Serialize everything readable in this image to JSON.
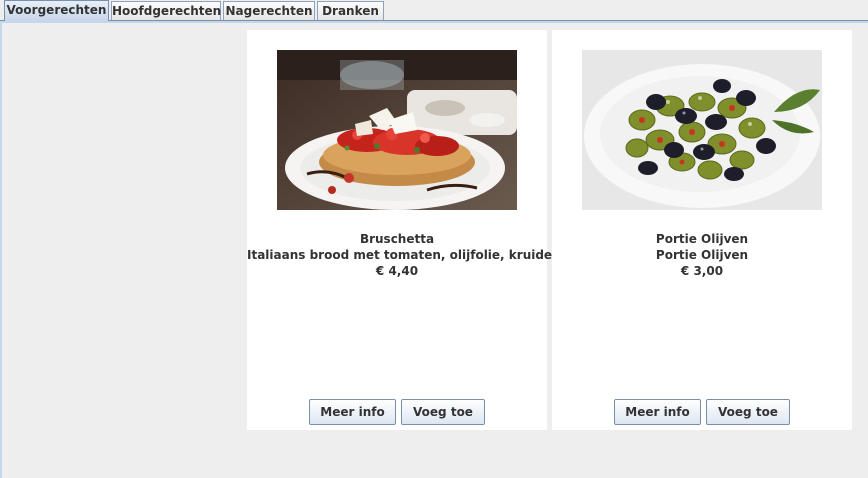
{
  "tabs": [
    {
      "label": "Voorgerechten",
      "active": true
    },
    {
      "label": "Hoofdgerechten",
      "active": false
    },
    {
      "label": "Nagerechten",
      "active": false
    },
    {
      "label": "Dranken",
      "active": false
    }
  ],
  "products": [
    {
      "name": "Bruschetta",
      "description": "Italiaans brood met tomaten, olijfolie, kruiden.",
      "price": "€ 4,40",
      "photo_icon": "bruschetta-photo",
      "info_label": "Meer info",
      "add_label": "Voeg toe"
    },
    {
      "name": "Portie Olijven",
      "description": "Portie Olijven",
      "price": "€ 3,00",
      "photo_icon": "olives-photo",
      "info_label": "Meer info",
      "add_label": "Voeg toe"
    }
  ],
  "colors": {
    "window_bg": "#eeeeee",
    "card_bg": "#ffffff",
    "tab_active": "#c6d7eb",
    "border": "#7a8fae",
    "text": "#333333"
  }
}
